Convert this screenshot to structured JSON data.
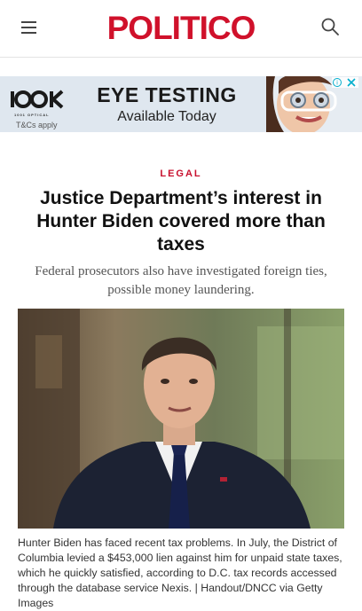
{
  "header": {
    "logo": "POLITICO",
    "menu_icon": "hamburger-menu-icon",
    "search_icon": "search-icon"
  },
  "ad": {
    "brand": "1001 OPTICAL",
    "headline": "EYE TESTING",
    "subline": "Available Today",
    "terms": "T&Cs apply",
    "ad_choices_icon": "adchoices-icon"
  },
  "article": {
    "kicker": "LEGAL",
    "headline": "Justice Department’s interest in Hunter Biden covered more than taxes",
    "dek": "Federal prosecutors also have investigated foreign ties, possible money laundering.",
    "caption": "Hunter Biden has faced recent tax problems. In July, the District of Columbia levied a $453,000 lien against him for unpaid state taxes, which he quickly satisfied, according to D.C. tax records accessed through the database service Nexis. | Handout/DNCC via Getty Images"
  },
  "colors": {
    "brand_red": "#d0112b",
    "kicker_red": "#c8102e",
    "ad_bg": "#dfe7ef"
  }
}
